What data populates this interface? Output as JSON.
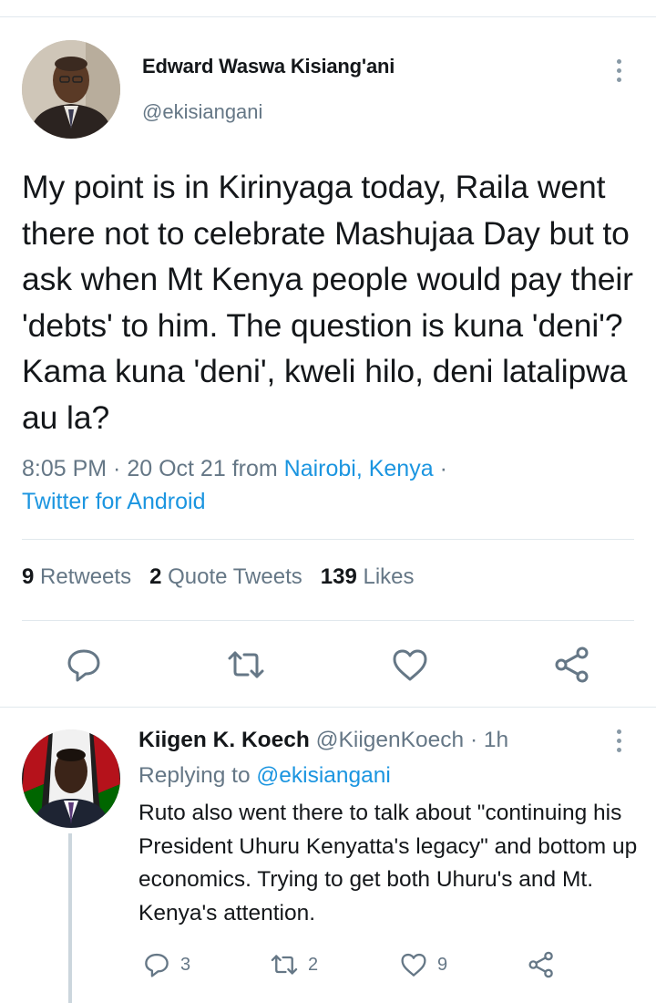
{
  "main_tweet": {
    "author": {
      "name": "Edward Waswa Kisiang'ani",
      "handle": "@ekisiangani",
      "avatar_icon": "profile-photo"
    },
    "text": "My point is in Kirinyaga today, Raila went there not to celebrate Mashujaa Day but to ask when Mt Kenya people would pay their 'debts' to him. The question is kuna 'deni'? Kama kuna 'deni', kweli hilo, deni latalipwa au la?",
    "time": "8:05 PM",
    "date": "20 Oct 21",
    "from_label": "from",
    "location": "Nairobi, Kenya",
    "client": "Twitter for Android",
    "stats": {
      "retweets_count": "9",
      "retweets_label": "Retweets",
      "quotes_count": "2",
      "quotes_label": "Quote Tweets",
      "likes_count": "139",
      "likes_label": "Likes"
    },
    "actions": [
      "reply-icon",
      "retweet-icon",
      "like-icon",
      "share-icon"
    ]
  },
  "reply_tweet": {
    "author": {
      "name": "Kiigen K. Koech",
      "handle": "@KiigenKoech",
      "time": "1h"
    },
    "replying_label": "Replying to",
    "replying_to": "@ekisiangani",
    "text": "Ruto also went there to talk about \"continuing his President Uhuru Kenyatta's legacy\" and bottom up economics. Trying to get both Uhuru's and Mt. Kenya's attention.",
    "reply_count": "3",
    "retweet_count": "2",
    "like_count": "9"
  },
  "colors": {
    "text": "#14171a",
    "secondary": "#657786",
    "link": "#1b95e0",
    "divider": "#e1e8ed",
    "icon": "#657786"
  }
}
